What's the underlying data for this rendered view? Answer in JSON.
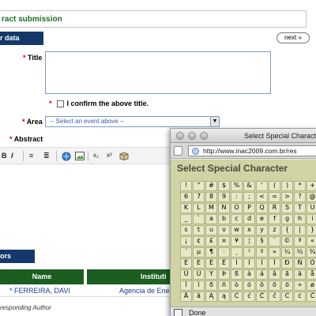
{
  "form": {
    "header": "ract submission",
    "tab_user_data": "r data",
    "next_label": "next »",
    "title_label": "Title",
    "confirm_label": "I confirm the above title.",
    "area_label": "Area",
    "area_select_value": "-- Select an event above --",
    "abstract_label": "Abstract",
    "required_marker": "*",
    "toolbar": {
      "bold": "B",
      "italic": "I",
      "list_ordered": "≡",
      "list_bullet": "≣",
      "subscript": "x₂",
      "superscript": "x²"
    },
    "tab_authors": "ors",
    "authors_table": {
      "headers": [
        "Name",
        "Instituti"
      ],
      "rows": [
        {
          "name": "* FERREIRA, DAVI",
          "institution": "Agencia de Energ"
        }
      ]
    },
    "note": "responding Author"
  },
  "popup": {
    "window_title": "Select Special Characte",
    "url": "http://www.inac2009.com.br/res",
    "heading": "Select Special Character",
    "status": "Done",
    "characters": [
      [
        "!",
        "\"",
        "#",
        "$",
        "%",
        "&",
        "'",
        "(",
        ")",
        "*",
        "+",
        ","
      ],
      [
        "6",
        "7",
        "8",
        "9",
        ":",
        ";",
        "<",
        "=",
        ">",
        "?",
        "@",
        "A"
      ],
      [
        "K",
        "L",
        "M",
        "N",
        "O",
        "P",
        "Q",
        "R",
        "S",
        "T",
        "U",
        "V"
      ],
      [
        "_",
        "`",
        "a",
        "b",
        "c",
        "d",
        "e",
        "f",
        "g",
        "h",
        "i",
        "j"
      ],
      [
        "s",
        "t",
        "u",
        "v",
        "w",
        "x",
        "y",
        "z",
        "{",
        "|",
        "}",
        "~"
      ],
      [
        "¡",
        "¢",
        "£",
        "¤",
        "¥",
        "¦",
        "§",
        "¨",
        "©",
        "ª",
        "«",
        "¬"
      ],
      [
        "´",
        "µ",
        "¶",
        "·",
        "¸",
        "¹",
        "º",
        "»",
        "¼",
        "½",
        "¾",
        "¿"
      ],
      [
        "È",
        "É",
        "Ê",
        "Ë",
        "Ì",
        "Í",
        "Î",
        "Ï",
        "Ð",
        "Ñ",
        "Ò",
        "Ó"
      ],
      [
        "Û",
        "Ü",
        "Ý",
        "Þ",
        "ß",
        "à",
        "á",
        "â",
        "ã",
        "ä",
        "å",
        "æ"
      ],
      [
        "î",
        "ï",
        "ð",
        "ñ",
        "ò",
        "ó",
        "ô",
        "õ",
        "ö",
        "÷",
        "ø",
        "ù"
      ],
      [
        "Ă",
        "ă",
        "Ą",
        "ą",
        "Ć",
        "ć",
        "Ĉ",
        "ĉ",
        "Ċ",
        "ċ",
        "Č",
        "č"
      ]
    ]
  },
  "colors": {
    "page_green": "#cdeccd",
    "header_green": "#1f6b24",
    "section_blue": "#14386a",
    "table_green": "#1b5e20",
    "popup_olive": "#d0d3a3"
  }
}
